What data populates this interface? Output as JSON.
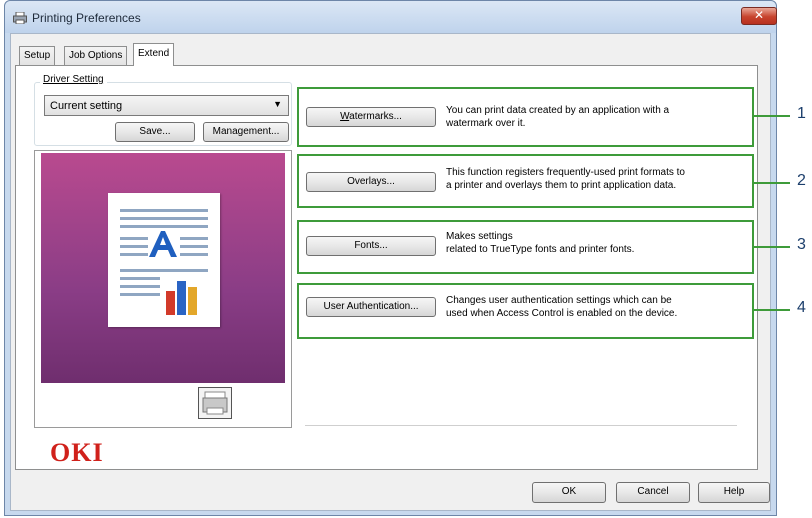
{
  "window": {
    "title": "Printing Preferences",
    "close_symbol": "✕"
  },
  "tabs": [
    {
      "label": "Setup",
      "active": false
    },
    {
      "label": "Job Options",
      "active": false
    },
    {
      "label": "Extend",
      "active": true
    }
  ],
  "driver_setting": {
    "label": "Driver Setting",
    "selected": "Current setting",
    "save_label": "Save...",
    "management_label": "Management..."
  },
  "logo": "OKI",
  "features": [
    {
      "button": "Watermarks...",
      "desc_line1": "You can print data created by an application with a",
      "desc_line2": "watermark over it.",
      "callout": "1"
    },
    {
      "button": "Overlays...",
      "desc_line1": "This function registers frequently-used print formats to",
      "desc_line2": "a printer and overlays them to print application data.",
      "callout": "2"
    },
    {
      "button": "Fonts...",
      "desc_line1": "Makes settings",
      "desc_line2": " related to TrueType fonts and printer fonts.",
      "callout": "3"
    },
    {
      "button": "User Authentication...",
      "desc_line1": "Changes user authentication settings which can be",
      "desc_line2": "used when Access Control is enabled on the device.",
      "callout": "4"
    }
  ],
  "footer": {
    "ok": "OK",
    "cancel": "Cancel",
    "help": "Help"
  },
  "colors": {
    "highlight_box": "#3e9b3a",
    "logo": "#d0211b",
    "preview_bg": "#9a3f88"
  }
}
